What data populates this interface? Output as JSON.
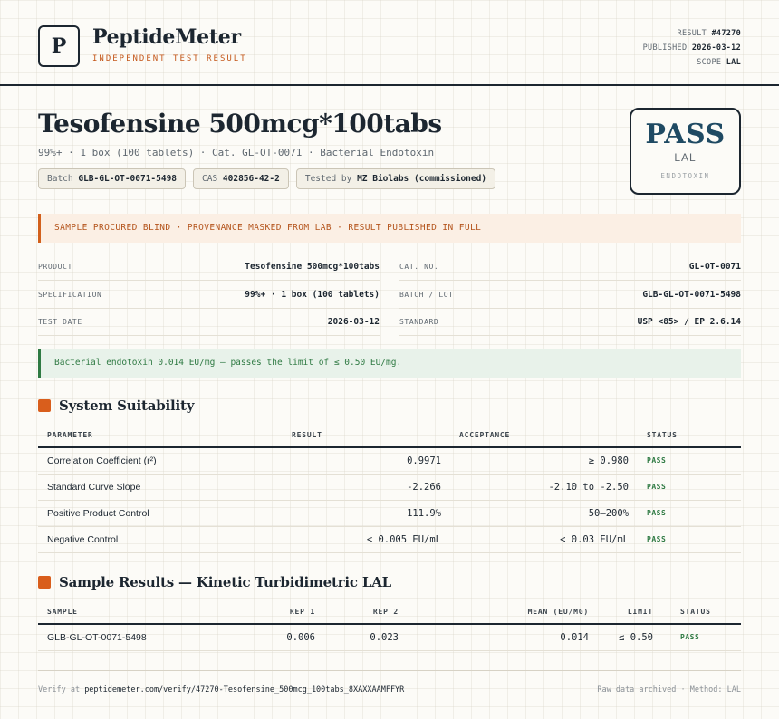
{
  "brand": {
    "logo_letter": "P",
    "name": "PeptideMeter",
    "tagline": "INDEPENDENT TEST RESULT"
  },
  "meta": {
    "result_label": "RESULT",
    "result_value": "#47270",
    "published_label": "PUBLISHED",
    "published_value": "2026-03-12",
    "scope_label": "SCOPE",
    "scope_value": "LAL"
  },
  "product": {
    "title": "Tesofensine 500mcg*100tabs",
    "subtitle": "99%+ · 1 box (100 tablets) · Cat. GL-OT-0071 · Bacterial Endotoxin",
    "chips": {
      "batch_label": "Batch",
      "batch_value": "GLB-GL-OT-0071-5498",
      "cas_label": "CAS",
      "cas_value": "402856-42-2",
      "tested_label": "Tested by",
      "tested_value": "MZ Biolabs (commissioned)"
    }
  },
  "stamp": {
    "verdict": "PASS",
    "method": "LAL",
    "category": "ENDOTOXIN"
  },
  "notice": "SAMPLE PROCURED BLIND · PROVENANCE MASKED FROM LAB · RESULT PUBLISHED IN FULL",
  "info": {
    "product_label": "PRODUCT",
    "product_value": "Tesofensine 500mcg*100tabs",
    "spec_label": "SPECIFICATION",
    "spec_value": "99%+ · 1 box (100 tablets)",
    "date_label": "TEST DATE",
    "date_value": "2026-03-12",
    "cat_label": "CAT. NO.",
    "cat_value": "GL-OT-0071",
    "batch_label": "BATCH / LOT",
    "batch_value": "GLB-GL-OT-0071-5498",
    "standard_label": "STANDARD",
    "standard_value": "USP <85> / EP 2.6.14"
  },
  "result_banner": "Bacterial endotoxin 0.014 EU/mg — passes the limit of ≤ 0.50 EU/mg.",
  "suitability": {
    "title": "System Suitability",
    "headers": {
      "parameter": "PARAMETER",
      "result": "RESULT",
      "acceptance": "ACCEPTANCE",
      "status": "STATUS"
    },
    "rows": [
      {
        "parameter": "Correlation Coefficient (r²)",
        "result": "0.9971",
        "acceptance": "≥ 0.980",
        "status": "PASS"
      },
      {
        "parameter": "Standard Curve Slope",
        "result": "-2.266",
        "acceptance": "-2.10 to -2.50",
        "status": "PASS"
      },
      {
        "parameter": "Positive Product Control",
        "result": "111.9%",
        "acceptance": "50–200%",
        "status": "PASS"
      },
      {
        "parameter": "Negative Control",
        "result": "< 0.005 EU/mL",
        "acceptance": "< 0.03 EU/mL",
        "status": "PASS"
      }
    ]
  },
  "samples": {
    "title": "Sample Results — Kinetic Turbidimetric LAL",
    "headers": {
      "sample": "SAMPLE",
      "rep1": "REP 1",
      "rep2": "REP 2",
      "mean": "MEAN (EU/MG)",
      "limit": "LIMIT",
      "status": "STATUS"
    },
    "rows": [
      {
        "sample": "GLB-GL-OT-0071-5498",
        "rep1": "0.006",
        "rep2": "0.023",
        "mean": "0.014",
        "limit": "≤ 0.50",
        "status": "PASS"
      }
    ]
  },
  "footer": {
    "verify_label": "Verify at",
    "verify_url": "peptidemeter.com/verify/47270-Tesofensine_500mcg_100tabs_8XAXXAAMFFYR",
    "right": "Raw data archived · Method: LAL"
  },
  "colors": {
    "ink": "#1c2630",
    "accent": "#d95e1c",
    "pass_green": "#2f7a43",
    "stamp_blue": "#1f4a63"
  }
}
